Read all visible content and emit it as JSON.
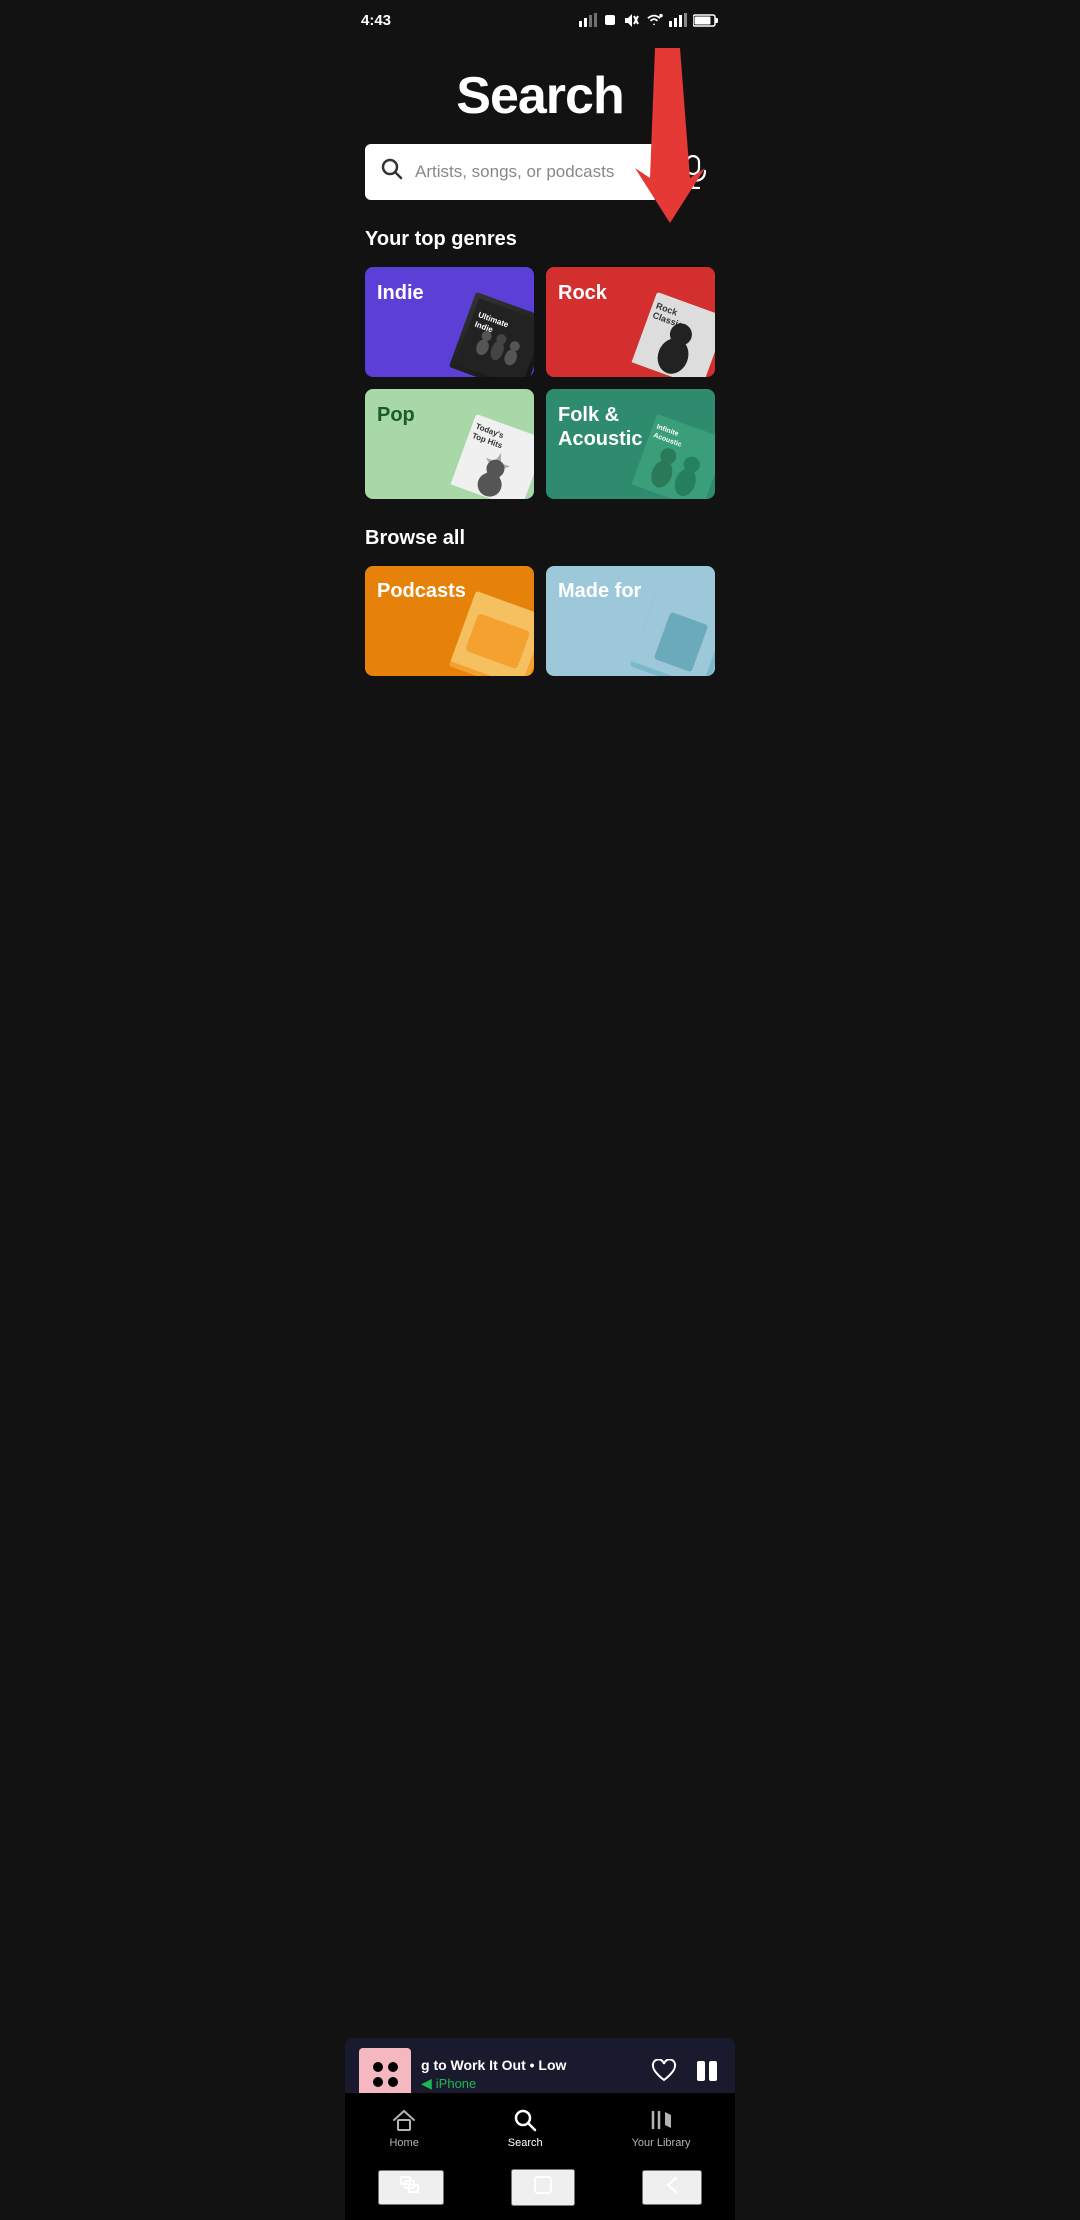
{
  "statusBar": {
    "time": "4:43",
    "icons": [
      "signal",
      "notification",
      "wifi",
      "signal2",
      "battery"
    ]
  },
  "pageTitle": "Search",
  "searchBar": {
    "placeholder": "Artists, songs, or podcasts",
    "micLabel": "Voice search"
  },
  "topGenres": {
    "sectionTitle": "Your top genres",
    "items": [
      {
        "id": "indie",
        "label": "Indie",
        "color": "#5B3FD6",
        "albumText": "Ultimate Indie"
      },
      {
        "id": "rock",
        "label": "Rock",
        "color": "#D32F2F",
        "albumText": "Rock Classics"
      },
      {
        "id": "pop",
        "label": "Pop",
        "color": "#A8D8A8",
        "albumText": "Today's Top Hits"
      },
      {
        "id": "folk",
        "label": "Folk &\nAcoustic",
        "color": "#2E8B6E",
        "albumText": "Infinite Acoustic"
      }
    ]
  },
  "browseAll": {
    "sectionTitle": "Browse all",
    "items": [
      {
        "id": "podcasts",
        "label": "Podcasts",
        "color": "#E6820A"
      },
      {
        "id": "madefor",
        "label": "Made for",
        "color": "#9DC8D9"
      }
    ]
  },
  "nowPlaying": {
    "songTitle": "g to Work It Out • Low",
    "device": "iPhone",
    "deviceIcon": "◀"
  },
  "bottomNav": {
    "items": [
      {
        "id": "home",
        "label": "Home",
        "icon": "⌂",
        "active": false
      },
      {
        "id": "search",
        "label": "Search",
        "icon": "⌕",
        "active": true
      },
      {
        "id": "library",
        "label": "Your Library",
        "icon": "𝄞",
        "active": false
      }
    ]
  },
  "androidNav": {
    "items": [
      {
        "id": "back",
        "icon": "❮"
      },
      {
        "id": "home",
        "icon": "⬜"
      },
      {
        "id": "recents",
        "icon": "⬛"
      }
    ]
  }
}
